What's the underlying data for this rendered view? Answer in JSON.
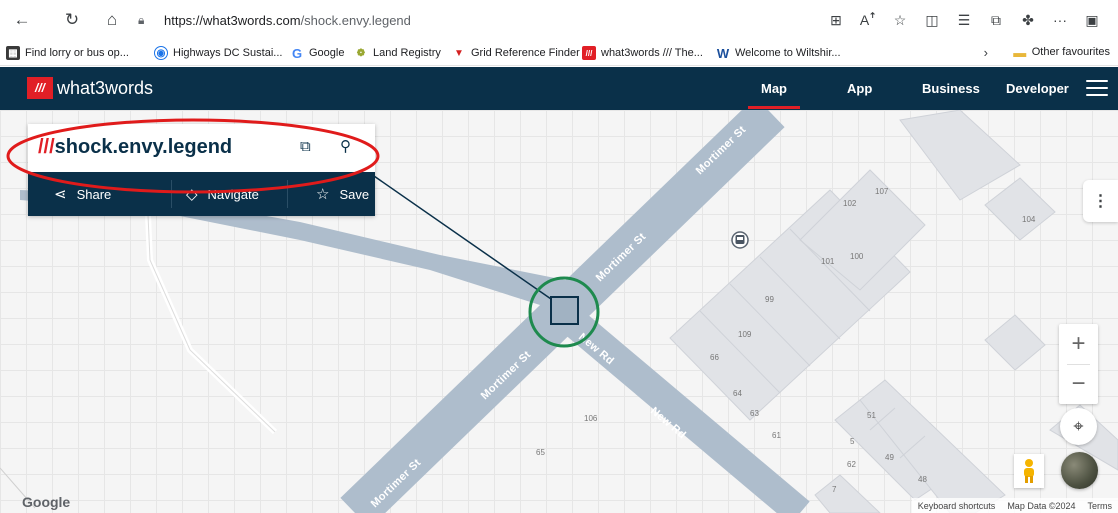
{
  "browser": {
    "url_host": "https://what3words.com",
    "url_path": "/shock.envy.legend",
    "bookmarks": [
      {
        "label": "Find lorry or bus op...",
        "icon": "building-icon"
      },
      {
        "label": "Highways DC Sustai...",
        "icon": "globe-icon"
      },
      {
        "label": "Google",
        "icon": "google-icon"
      },
      {
        "label": "Land Registry",
        "icon": "crest-icon"
      },
      {
        "label": "Grid Reference Finder",
        "icon": "pin-icon"
      },
      {
        "label": "what3words /// The...",
        "icon": "w3w-icon"
      },
      {
        "label": "Welcome to Wiltshir...",
        "icon": "w-icon"
      }
    ],
    "other_favourites": "Other favourites"
  },
  "header": {
    "logo_text": "what3words",
    "nav": [
      "Map",
      "App",
      "Business",
      "Developer"
    ]
  },
  "card": {
    "slashes": "///",
    "address": "shock.envy.legend",
    "actions": {
      "share": "Share",
      "navigate": "Navigate",
      "save": "Save"
    }
  },
  "map": {
    "road_labels": [
      "Mortimer St",
      "Mortimer St",
      "Mortimer St",
      "Mortimer St",
      "New Rd",
      "New Rd"
    ],
    "house_numbers": [
      "107",
      "102",
      "104",
      "100",
      "101",
      "99",
      "109",
      "66",
      "64",
      "63",
      "61",
      "51",
      "5",
      "62",
      "49",
      "48",
      "7",
      "106",
      "65"
    ],
    "google": "Google",
    "attribution": {
      "shortcuts": "Keyboard shortcuts",
      "data": "Map Data ©2024",
      "terms": "Terms"
    }
  },
  "colors": {
    "brand_red": "#e11f26",
    "navy": "#0a3049",
    "road": "#aebdcc",
    "highlight_red": "#e01b1b",
    "highlight_green": "#1e8a4e"
  }
}
